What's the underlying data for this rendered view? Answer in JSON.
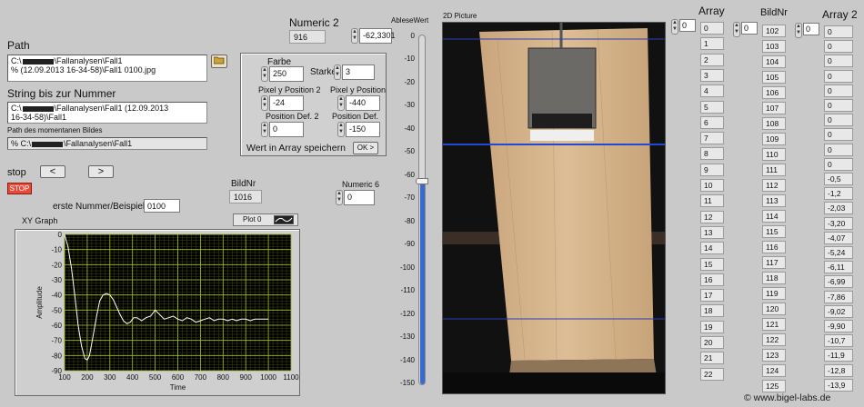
{
  "path": {
    "label": "Path",
    "value_line1": "C:\\",
    "value_mid": "\\Fallanalysen\\Fall1",
    "value_line2": "(12.09.2013 16-34-58)\\Fall1 0100.jpg",
    "prefix": "%"
  },
  "string_bis": {
    "label": "String bis zur Nummer",
    "line1_a": "C:\\",
    "line1_b": "\\Fallanalysen\\Fall1 (12.09.2013",
    "line2": "16-34-58)\\Fall1"
  },
  "current_path": {
    "label": "Path des momentanen Bildes",
    "prefix": "%",
    "value_a": "C:\\",
    "value_b": "\\Fallanalysen\\Fall1"
  },
  "stop": {
    "label": "stop",
    "button": "STOP"
  },
  "nav": {
    "prev": "<",
    "next": ">"
  },
  "erste_nummer": {
    "label": "erste Nummer/Beispiel",
    "value": "0100"
  },
  "bildnr_top": {
    "label": "BildNr",
    "value": "1016"
  },
  "numeric2": {
    "label": "Numeric 2",
    "value": "916",
    "value2": "-62,3301"
  },
  "numeric6": {
    "label": "Numeric 6",
    "value": "0"
  },
  "settings": {
    "farbe_label": "Farbe",
    "farbe_value": "250",
    "starke_label": "Starke",
    "starke_value": "3",
    "pixel_y2_label": "Pixel y Position 2",
    "pixel_y2_value": "-24",
    "pixel_y_label": "Pixel y Position",
    "pixel_y_value": "-440",
    "posdef2_label": "Position Def. 2",
    "posdef2_value": "0",
    "posdef_label": "Position Def.",
    "posdef_value": "-150",
    "save_label": "Wert in Array speichern",
    "ok": "OK >"
  },
  "xy_graph": {
    "title": "XY Graph",
    "legend": "Plot 0",
    "xlabel": "Time",
    "ylabel": "Amplitude"
  },
  "slider": {
    "label": "AbleseWert",
    "ticks": [
      "0",
      "-10",
      "-20",
      "-30",
      "-40",
      "-50",
      "-60",
      "-70",
      "-80",
      "-90",
      "-100",
      "-110",
      "-120",
      "-130",
      "-140",
      "-150"
    ],
    "value": -62.3301
  },
  "picture": {
    "label": "2D Picture"
  },
  "array": {
    "label": "Array",
    "index": "0",
    "values": [
      "0",
      "1",
      "2",
      "3",
      "4",
      "5",
      "6",
      "7",
      "8",
      "9",
      "10",
      "11",
      "12",
      "13",
      "14",
      "15",
      "16",
      "17",
      "18",
      "19",
      "20",
      "21",
      "22"
    ],
    "first": "0"
  },
  "bildnr_array": {
    "label": "BildNr",
    "index": "0",
    "values": [
      "102",
      "103",
      "104",
      "105",
      "106",
      "107",
      "108",
      "109",
      "110",
      "111",
      "112",
      "113",
      "114",
      "115",
      "116",
      "117",
      "118",
      "119",
      "120",
      "121",
      "122",
      "123",
      "124",
      "125"
    ]
  },
  "array2": {
    "label": "Array 2",
    "index": "0",
    "values": [
      "0",
      "0",
      "0",
      "0",
      "0",
      "0",
      "0",
      "0",
      "0",
      "0",
      "-0,5",
      "-1,2",
      "-2,03",
      "-3,20",
      "-4,07",
      "-5,24",
      "-6,11",
      "-6,99",
      "-7,86",
      "-9,02",
      "-9,90",
      "-10,7",
      "-11,9",
      "-12,8",
      "-13,9"
    ]
  },
  "watermark": "© www.bigel-labs.de",
  "chart_data": {
    "type": "line",
    "xlabel": "Time",
    "ylabel": "Amplitude",
    "xlim": [
      100,
      1100
    ],
    "ylim": [
      -90,
      0
    ],
    "xticks": [
      100,
      200,
      300,
      400,
      500,
      600,
      700,
      800,
      900,
      1000,
      1100
    ],
    "yticks": [
      0,
      -10,
      -20,
      -30,
      -40,
      -50,
      -60,
      -70,
      -80,
      -90
    ],
    "series": [
      {
        "name": "Plot 0",
        "x": [
          100,
          115,
          130,
          145,
          160,
          175,
          190,
          200,
          210,
          225,
          240,
          255,
          270,
          285,
          300,
          315,
          330,
          345,
          360,
          375,
          390,
          405,
          420,
          440,
          460,
          480,
          500,
          520,
          540,
          560,
          580,
          600,
          620,
          640,
          660,
          680,
          700,
          720,
          740,
          760,
          780,
          800,
          820,
          840,
          860,
          880,
          900,
          920,
          940,
          960,
          980,
          1000
        ],
        "y": [
          0,
          -8,
          -22,
          -40,
          -60,
          -74,
          -82,
          -83,
          -80,
          -68,
          -55,
          -44,
          -40,
          -39,
          -40,
          -43,
          -48,
          -53,
          -57,
          -59,
          -58,
          -55,
          -55,
          -57,
          -55,
          -54,
          -50,
          -53,
          -56,
          -55,
          -54,
          -56,
          -57,
          -55,
          -56,
          -58,
          -57,
          -56,
          -55,
          -57,
          -56,
          -56,
          -57,
          -56,
          -57,
          -56,
          -56,
          -57,
          -56,
          -56,
          -56,
          -56
        ]
      }
    ]
  }
}
